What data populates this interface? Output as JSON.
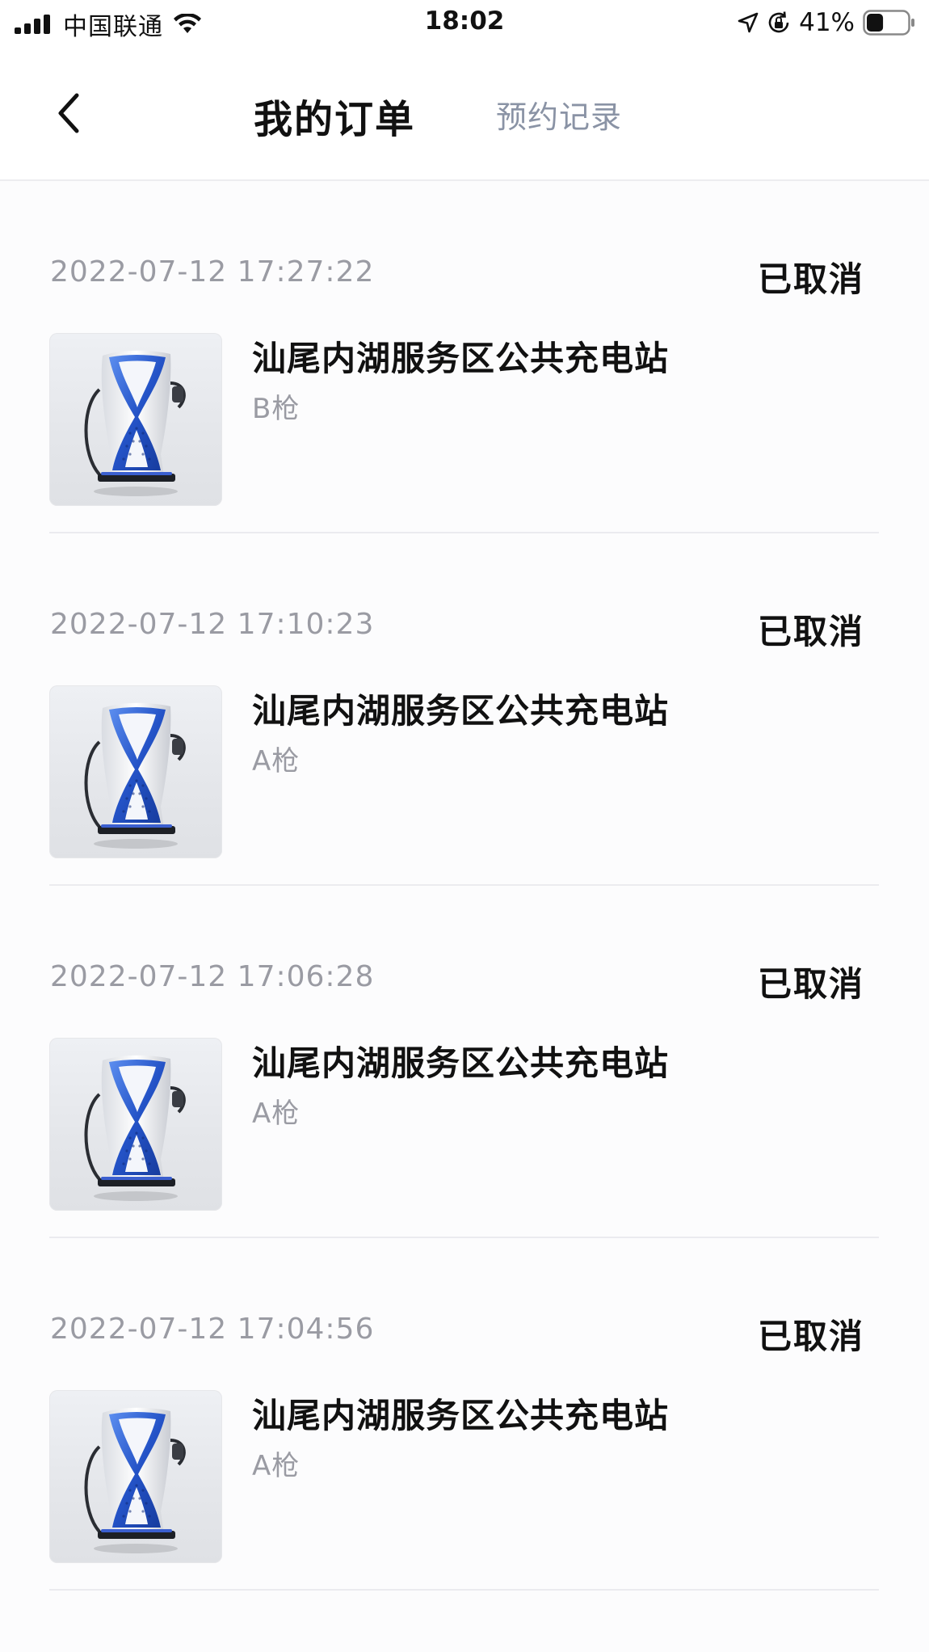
{
  "status_bar": {
    "carrier": "中国联通",
    "time": "18:02",
    "battery": "41%",
    "battery_level": 0.41,
    "icons": [
      "signal-icon",
      "wifi-icon",
      "location-arrow-icon",
      "rotation-lock-icon",
      "battery-icon"
    ]
  },
  "nav": {
    "back_icon": "chevron-left-icon",
    "tabs": [
      {
        "label": "我的订单",
        "active": true
      },
      {
        "label": "预约记录",
        "active": false
      }
    ]
  },
  "orders": [
    {
      "time": "2022-07-12 17:27:22",
      "status": "已取消",
      "station": "汕尾内湖服务区公共充电站",
      "gun": "B枪"
    },
    {
      "time": "2022-07-12 17:10:23",
      "status": "已取消",
      "station": "汕尾内湖服务区公共充电站",
      "gun": "A枪"
    },
    {
      "time": "2022-07-12 17:06:28",
      "status": "已取消",
      "station": "汕尾内湖服务区公共充电站",
      "gun": "A枪"
    },
    {
      "time": "2022-07-12 17:04:56",
      "status": "已取消",
      "station": "汕尾内湖服务区公共充电站",
      "gun": "A枪"
    }
  ],
  "colors": {
    "inactive_tab": "#8a93a5",
    "secondary_text": "#9a9ba3",
    "charger_accent": "#2f63d6"
  }
}
